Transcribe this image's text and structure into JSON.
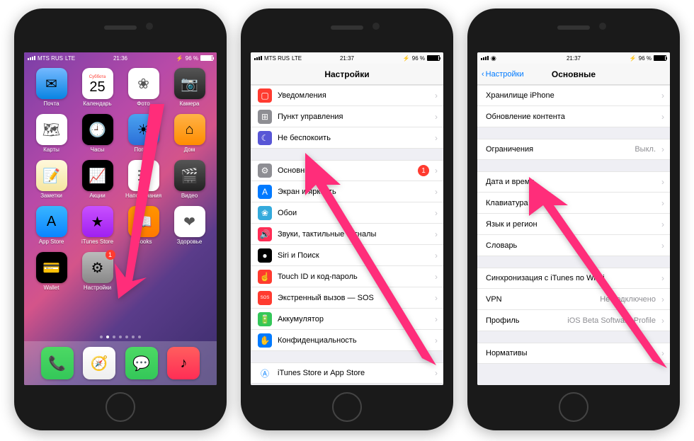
{
  "status": {
    "carrier": "MTS RUS",
    "network": "LTE",
    "battery_pct": "96 %",
    "times": [
      "21:36",
      "21:37",
      "21:37"
    ]
  },
  "home": {
    "calendar_day": "25",
    "calendar_weekday": "Суббота",
    "apps_row1": [
      {
        "label": "Почта",
        "color": "linear-gradient(#74b9ff,#0984e3)",
        "glyph": "✉"
      },
      {
        "label": "Календарь",
        "cal": true
      },
      {
        "label": "Фото",
        "color": "#fff",
        "glyph": "❀"
      },
      {
        "label": "Камера",
        "color": "linear-gradient(#555,#222)",
        "glyph": "📷"
      }
    ],
    "apps_row2": [
      {
        "label": "Карты",
        "color": "#fff",
        "glyph": "🗺"
      },
      {
        "label": "Часы",
        "color": "#000",
        "glyph": "🕘"
      },
      {
        "label": "Погода",
        "color": "linear-gradient(#4aa3f0,#2b6fd8)",
        "glyph": "☀"
      },
      {
        "label": "Дом",
        "color": "linear-gradient(#ffb347,#ff8c00)",
        "glyph": "⌂"
      }
    ],
    "apps_row3": [
      {
        "label": "Заметки",
        "color": "linear-gradient(#fff8dc,#f5e6a0)",
        "glyph": "📝"
      },
      {
        "label": "Акции",
        "color": "#000",
        "glyph": "📈"
      },
      {
        "label": "Напоминания",
        "color": "#fff",
        "glyph": "☰"
      },
      {
        "label": "Видео",
        "color": "linear-gradient(#555,#222)",
        "glyph": "🎬"
      }
    ],
    "apps_row4": [
      {
        "label": "App Store",
        "color": "linear-gradient(#38b6ff,#0a84ff)",
        "glyph": "A"
      },
      {
        "label": "iTunes Store",
        "color": "linear-gradient(#c850ff,#a020f0)",
        "glyph": "★"
      },
      {
        "label": "iBooks",
        "color": "linear-gradient(#ff9500,#ff7a00)",
        "glyph": "📖"
      },
      {
        "label": "Здоровье",
        "color": "#fff",
        "glyph": "❤"
      }
    ],
    "apps_row5": [
      {
        "label": "Wallet",
        "color": "#000",
        "glyph": "💳"
      },
      {
        "label": "Настройки",
        "color": "linear-gradient(#bbb,#888)",
        "glyph": "⚙",
        "badge": "1"
      }
    ],
    "dock": [
      {
        "color": "linear-gradient(#4cd964,#34c759)",
        "glyph": "📞"
      },
      {
        "color": "linear-gradient(#fff,#eee)",
        "glyph": "🧭"
      },
      {
        "color": "linear-gradient(#4cd964,#34c759)",
        "glyph": "💬"
      },
      {
        "color": "linear-gradient(#ff5e5e,#ff2d55)",
        "glyph": "♪"
      }
    ]
  },
  "settings": {
    "title": "Настройки",
    "group1": [
      {
        "icon_color": "#ff3b30",
        "glyph": "▢",
        "label": "Уведомления"
      },
      {
        "icon_color": "#8e8e93",
        "glyph": "⊞",
        "label": "Пункт управления"
      },
      {
        "icon_color": "#5856d6",
        "glyph": "☾",
        "label": "Не беспокоить"
      }
    ],
    "group2": [
      {
        "icon_color": "#8e8e93",
        "glyph": "⚙",
        "label": "Основные",
        "badge": "1"
      },
      {
        "icon_color": "#007aff",
        "glyph": "A",
        "label": "Экран и яркость"
      },
      {
        "icon_color": "#34aadc",
        "glyph": "❀",
        "label": "Обои"
      },
      {
        "icon_color": "#ff2d55",
        "glyph": "🔊",
        "label": "Звуки, тактильные сигналы"
      },
      {
        "icon_color": "#000",
        "glyph": "●",
        "label": "Siri и Поиск"
      },
      {
        "icon_color": "#ff3b30",
        "glyph": "☝",
        "label": "Touch ID и код-пароль"
      },
      {
        "icon_color": "#ff3b30",
        "glyph": "SOS",
        "label": "Экстренный вызов — SOS"
      },
      {
        "icon_color": "#34c759",
        "glyph": "🔋",
        "label": "Аккумулятор"
      },
      {
        "icon_color": "#007aff",
        "glyph": "✋",
        "label": "Конфиденциальность"
      }
    ],
    "group3": [
      {
        "icon_color": "#fff",
        "glyph": "Ⓐ",
        "label": "iTunes Store и App Store",
        "icon_text_color": "#0a84ff"
      }
    ]
  },
  "general": {
    "title": "Основные",
    "back": "Настройки",
    "group1": [
      {
        "label": "Хранилище iPhone"
      },
      {
        "label": "Обновление контента"
      }
    ],
    "group2": [
      {
        "label": "Ограничения",
        "value": "Выкл."
      }
    ],
    "group3": [
      {
        "label": "Дата и время"
      },
      {
        "label": "Клавиатура"
      },
      {
        "label": "Язык и регион"
      },
      {
        "label": "Словарь"
      }
    ],
    "group4": [
      {
        "label": "Синхронизация с iTunes по Wi-Fi"
      },
      {
        "label": "VPN",
        "value": "Не подключено"
      },
      {
        "label": "Профиль",
        "value": "iOS Beta Software Profile"
      }
    ],
    "group5": [
      {
        "label": "Нормативы"
      }
    ]
  },
  "arrow_color": "#ff2d7a"
}
